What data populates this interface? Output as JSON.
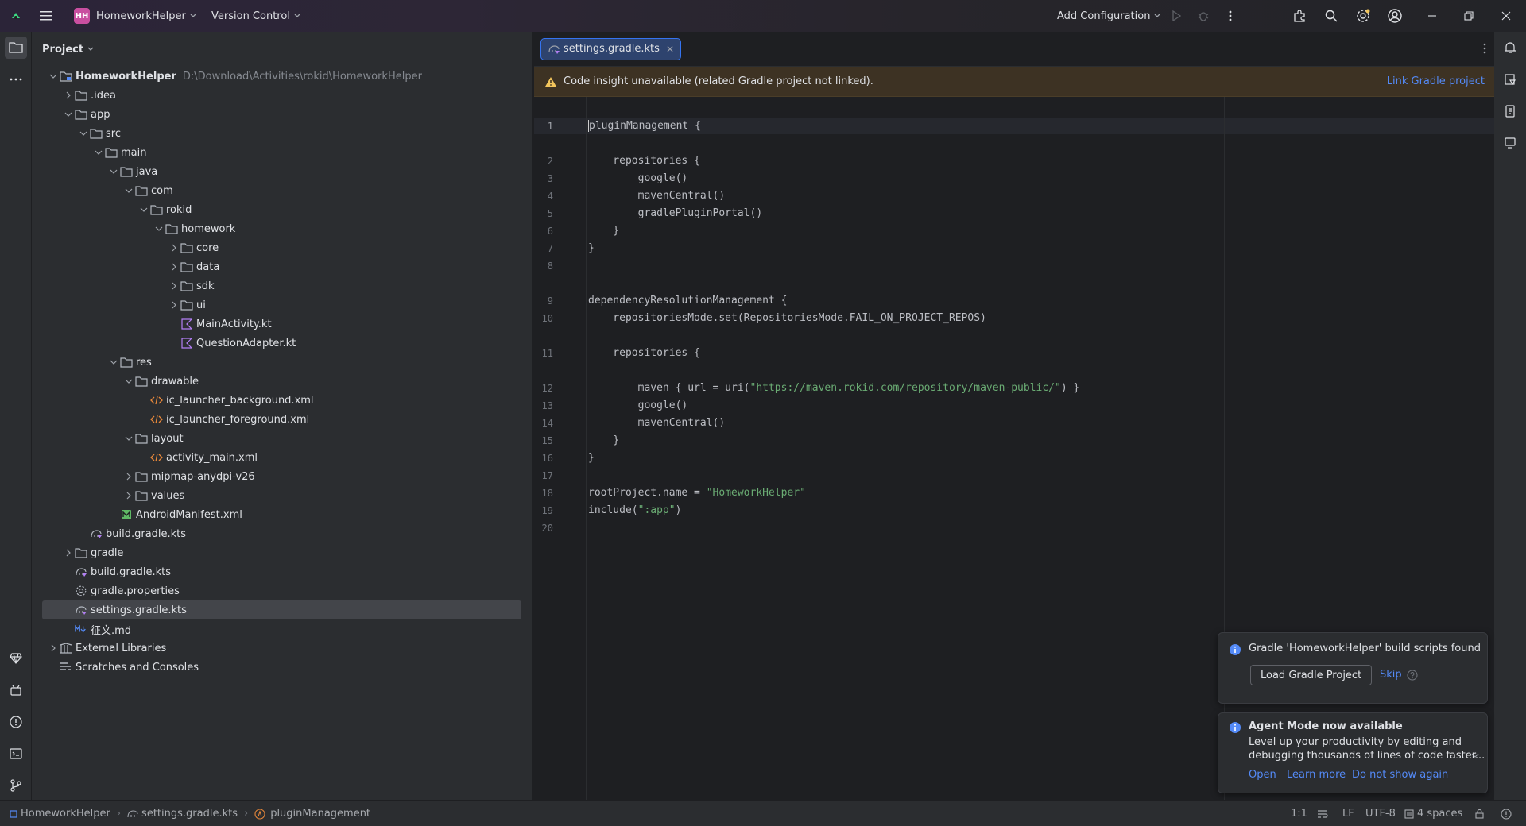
{
  "titlebar": {
    "project_initials": "HH",
    "project_name": "HomeworkHelper",
    "version_control": "Version Control",
    "add_configuration": "Add Configuration"
  },
  "project_panel": {
    "title": "Project",
    "tree": [
      {
        "label": "HomeworkHelper",
        "path": "D:\\Download\\Activities\\rokid\\HomeworkHelper",
        "depth": 0,
        "arrow": "down",
        "icon": "module"
      },
      {
        "label": ".idea",
        "depth": 1,
        "arrow": "right",
        "icon": "folder"
      },
      {
        "label": "app",
        "depth": 1,
        "arrow": "down",
        "icon": "folder"
      },
      {
        "label": "src",
        "depth": 2,
        "arrow": "down",
        "icon": "folder"
      },
      {
        "label": "main",
        "depth": 3,
        "arrow": "down",
        "icon": "folder"
      },
      {
        "label": "java",
        "depth": 4,
        "arrow": "down",
        "icon": "folder"
      },
      {
        "label": "com",
        "depth": 5,
        "arrow": "down",
        "icon": "folder"
      },
      {
        "label": "rokid",
        "depth": 6,
        "arrow": "down",
        "icon": "folder"
      },
      {
        "label": "homework",
        "depth": 7,
        "arrow": "down",
        "icon": "folder"
      },
      {
        "label": "core",
        "depth": 8,
        "arrow": "right",
        "icon": "folder"
      },
      {
        "label": "data",
        "depth": 8,
        "arrow": "right",
        "icon": "folder"
      },
      {
        "label": "sdk",
        "depth": 8,
        "arrow": "right",
        "icon": "folder"
      },
      {
        "label": "ui",
        "depth": 8,
        "arrow": "right",
        "icon": "folder"
      },
      {
        "label": "MainActivity.kt",
        "depth": 8,
        "arrow": "none",
        "icon": "kotlin"
      },
      {
        "label": "QuestionAdapter.kt",
        "depth": 8,
        "arrow": "none",
        "icon": "kotlin"
      },
      {
        "label": "res",
        "depth": 4,
        "arrow": "down",
        "icon": "folder"
      },
      {
        "label": "drawable",
        "depth": 5,
        "arrow": "down",
        "icon": "folder"
      },
      {
        "label": "ic_launcher_background.xml",
        "depth": 6,
        "arrow": "none",
        "icon": "xml"
      },
      {
        "label": "ic_launcher_foreground.xml",
        "depth": 6,
        "arrow": "none",
        "icon": "xml"
      },
      {
        "label": "layout",
        "depth": 5,
        "arrow": "down",
        "icon": "folder"
      },
      {
        "label": "activity_main.xml",
        "depth": 6,
        "arrow": "none",
        "icon": "xml"
      },
      {
        "label": "mipmap-anydpi-v26",
        "depth": 5,
        "arrow": "right",
        "icon": "folder"
      },
      {
        "label": "values",
        "depth": 5,
        "arrow": "right",
        "icon": "folder"
      },
      {
        "label": "AndroidManifest.xml",
        "depth": 4,
        "arrow": "none",
        "icon": "manifest"
      },
      {
        "label": "build.gradle.kts",
        "depth": 2,
        "arrow": "none",
        "icon": "gradle"
      },
      {
        "label": "gradle",
        "depth": 1,
        "arrow": "right",
        "icon": "folder"
      },
      {
        "label": "build.gradle.kts",
        "depth": 1,
        "arrow": "none",
        "icon": "gradle"
      },
      {
        "label": "gradle.properties",
        "depth": 1,
        "arrow": "none",
        "icon": "gear"
      },
      {
        "label": "settings.gradle.kts",
        "depth": 1,
        "arrow": "none",
        "icon": "gradle",
        "selected": true
      },
      {
        "label": "征文.md",
        "depth": 1,
        "arrow": "none",
        "icon": "markdown"
      },
      {
        "label": "External Libraries",
        "depth": 0,
        "arrow": "right",
        "icon": "library"
      },
      {
        "label": "Scratches and Consoles",
        "depth": 0,
        "arrow": "none",
        "icon": "scratches"
      }
    ]
  },
  "editor": {
    "tab_label": "settings.gradle.kts",
    "banner_text": "Code insight unavailable (related Gradle project not linked).",
    "banner_link": "Link Gradle project",
    "lines": [
      {
        "n": "1",
        "text": "pluginManagement {"
      },
      {
        "n": "2",
        "text": "    repositories {"
      },
      {
        "n": "3",
        "text": "        google()"
      },
      {
        "n": "4",
        "text": "        mavenCentral()"
      },
      {
        "n": "5",
        "text": "        gradlePluginPortal()"
      },
      {
        "n": "6",
        "text": "    }"
      },
      {
        "n": "7",
        "text": "}"
      },
      {
        "n": "8",
        "text": ""
      },
      {
        "n": "9",
        "text": "dependencyResolutionManagement {"
      },
      {
        "n": "10",
        "text": "    repositoriesMode.set(RepositoriesMode.FAIL_ON_PROJECT_REPOS)"
      },
      {
        "n": "11",
        "text": "    repositories {"
      },
      {
        "n": "12",
        "pre": "        maven { url = uri(",
        "str": "\"https://maven.rokid.com/repository/maven-public/\"",
        "post": ") }"
      },
      {
        "n": "13",
        "text": "        google()"
      },
      {
        "n": "14",
        "text": "        mavenCentral()"
      },
      {
        "n": "15",
        "text": "    }"
      },
      {
        "n": "16",
        "text": "}"
      },
      {
        "n": "17",
        "text": ""
      },
      {
        "n": "18",
        "pre": "rootProject.name = ",
        "str": "\"HomeworkHelper\"",
        "post": ""
      },
      {
        "n": "19",
        "pre": "include(",
        "str": "\":app\"",
        "post": ")"
      },
      {
        "n": "20",
        "text": ""
      }
    ]
  },
  "notifications": {
    "gradle": {
      "title": "Gradle 'HomeworkHelper' build scripts found",
      "load_button": "Load Gradle Project",
      "skip": "Skip"
    },
    "agent": {
      "title": "Agent Mode now available",
      "body_line1": "Level up your productivity by editing and",
      "body_line2": "debugging thousands of lines of code faster...",
      "open": "Open",
      "learn_more": "Learn more",
      "dismiss": "Do not show again"
    }
  },
  "statusbar": {
    "breadcrumb_project": "HomeworkHelper",
    "breadcrumb_file": "settings.gradle.kts",
    "breadcrumb_symbol": "pluginManagement",
    "position": "1:1",
    "line_ending": "LF",
    "encoding": "UTF-8",
    "indent": "4 spaces"
  },
  "colors": {
    "accent": "#3574f0",
    "link": "#548af7",
    "string": "#6aab73",
    "folder_icon": "#b3b8c0",
    "kotlin_icon": "#b37ff5",
    "xml_icon": "#e8883a",
    "manifest_icon": "#5fb865",
    "warning": "#f2c55c",
    "info": "#548af7"
  }
}
